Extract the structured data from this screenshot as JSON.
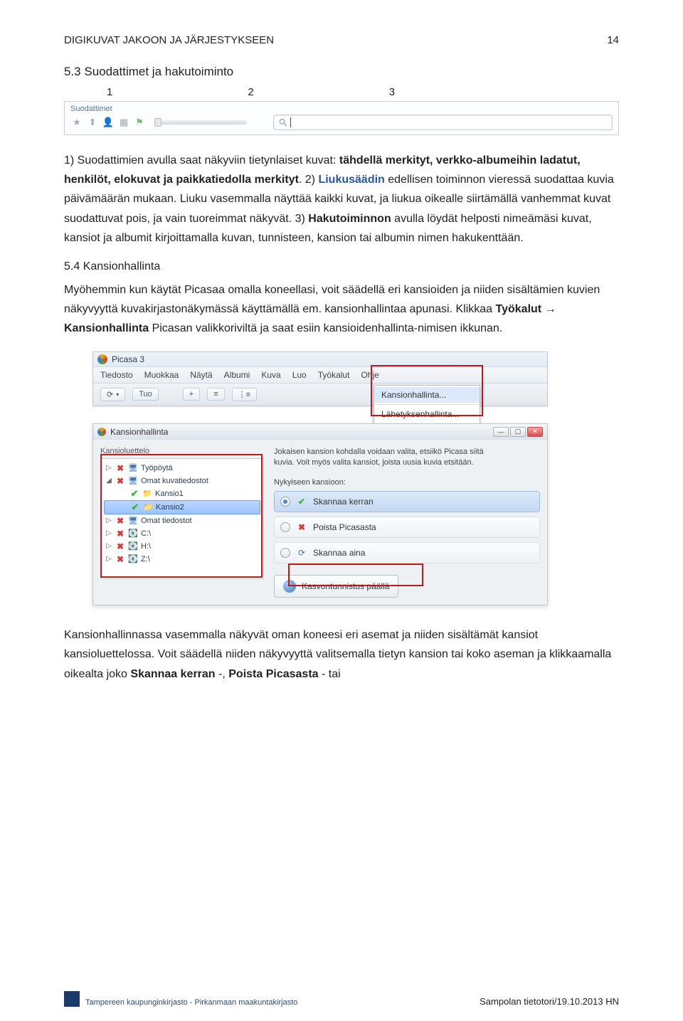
{
  "header": {
    "title": "DIGIKUVAT JAKOON JA JÄRJESTYKSEEN",
    "pageNumber": "14"
  },
  "section53": {
    "heading": "5.3 Suodattimet ja hakutoiminto",
    "labels": {
      "l1": "1",
      "l2": "2",
      "l3": "3"
    },
    "toolbar": {
      "groupLabel": "Suodattimet",
      "searchPlaceholder": ""
    },
    "paragraph_parts": {
      "p1a": "1) Suodattimien avulla saat näkyviin tietynlaiset kuvat: ",
      "p1b": "tähdellä merkityt, verkko-albumeihin ladatut, henkilöt, elokuvat ja paikkatiedolla merkityt",
      "p1c": ". 2) ",
      "p1d": "Liukusäädin",
      "p1e": " edellisen toiminnon vieressä suodattaa kuvia päivämäärän mukaan. Liuku vasemmalla näyttää kaikki kuvat, ja liukua oikealle siirtämällä vanhemmat kuvat suodattuvat pois, ja vain tuoreimmat näkyvät. 3) ",
      "p1f": "Hakutoiminnon",
      "p1g": " avulla löydät helposti nimeämäsi kuvat, kansiot ja albumit kirjoittamalla kuvan, tunnisteen, kansion tai albumin nimen hakukenttään."
    }
  },
  "section54": {
    "heading": "5.4 Kansionhallinta",
    "paragraph_parts": {
      "a": "Myöhemmin kun käytät Picasaa omalla koneellasi, voit säädellä eri kansioiden ja niiden sisältämien kuvien näkyvyyttä kuvakirjastonäkymässä käyttämällä em. kansionhallintaa apunasi. Klikkaa ",
      "b": "Työkalut",
      "arrow": " → ",
      "c": "Kansionhallinta",
      "d": " Picasan valikkoriviltä ja saat esiin kansioidenhallinta-nimisen ikkunan."
    }
  },
  "picasa": {
    "appTitle": "Picasa 3",
    "menus": [
      "Tiedosto",
      "Muokkaa",
      "Näytä",
      "Albumi",
      "Kuva",
      "Luo",
      "Työkalut",
      "Ohje"
    ],
    "toolbarBtn1": "⟳",
    "toolbarBtn2": "Tuo",
    "toolbarSmall": [
      "+",
      "≡",
      "⋮≡"
    ],
    "dropdown": {
      "item1": "Kansionhallinta...",
      "item2": "Lähetyksenhallinta..."
    }
  },
  "kh": {
    "windowTitle": "Kansionhallinta",
    "leftLabel": "Kansioluettelo",
    "tree": [
      {
        "expander": "▷",
        "icon": "x",
        "folderType": "pc",
        "label": "Työpöytä"
      },
      {
        "expander": "◢",
        "icon": "x",
        "folderType": "pc",
        "label": "Omat kuvatiedostot"
      },
      {
        "expander": "",
        "icon": "chk",
        "folderType": "folder",
        "label": "Kansio1",
        "indent": 1
      },
      {
        "expander": "",
        "icon": "chk",
        "folderType": "folder",
        "label": "Kansio2",
        "indent": 1,
        "selected": true
      },
      {
        "expander": "▷",
        "icon": "x",
        "folderType": "pc",
        "label": "Omat tiedostot"
      },
      {
        "expander": "▷",
        "icon": "x",
        "folderType": "disk",
        "label": "C:\\"
      },
      {
        "expander": "▷",
        "icon": "x",
        "folderType": "disk",
        "label": "H:\\"
      },
      {
        "expander": "▷",
        "icon": "x",
        "folderType": "disk",
        "label": "Z:\\"
      }
    ],
    "desc": "Jokaisen kansion kohdalla voidaan valita, etsiikö Picasa siitä kuvia. Voit myös valita kansiot, joista uusia kuvia etsitään.",
    "groupLabel": "Nykyiseen kansioon:",
    "options": {
      "scanOnce": "Skannaa kerran",
      "remove": "Poista Picasasta",
      "scanAlways": "Skannaa aina"
    },
    "faceBtn": "Kasvontunnistus päällä"
  },
  "bottomParagraph": {
    "a": "Kansionhallinnassa vasemmalla näkyvät oman koneesi eri asemat ja niiden sisältämät kansiot kansioluettelossa. Voit säädellä niiden näkyvyyttä valitsemalla tietyn kansion tai koko aseman ja klikkaamalla oikealta joko ",
    "b": "Skannaa kerran",
    "c": " -, ",
    "d": "Poista Picasasta",
    "e": " - tai"
  },
  "footer": {
    "org": "Tampereen kaupunginkirjasto - Pirkanmaan maakuntakirjasto",
    "right": "Sampolan tietotori/19.10.2013 HN"
  }
}
